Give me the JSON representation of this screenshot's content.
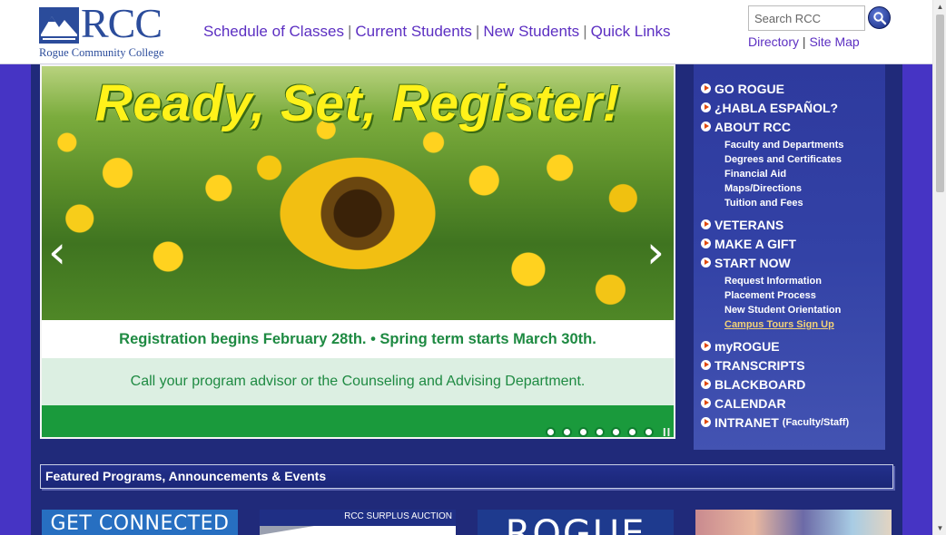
{
  "logo": {
    "abbr": "RCC",
    "name": "Rogue Community College"
  },
  "topnav": {
    "items": [
      "Schedule of Classes",
      "Current Students",
      "New Students",
      "Quick Links"
    ],
    "separator": "|"
  },
  "search": {
    "placeholder": "Search RCC",
    "button_icon": "search-icon"
  },
  "util_links": {
    "directory": "Directory",
    "separator": "|",
    "sitemap": "Site Map"
  },
  "hero": {
    "title": "Ready, Set, Register!",
    "line1": "Registration begins February 28th. • Spring term starts March 30th.",
    "line2": "Call your program advisor or the Counseling and Advising Department.",
    "prev_icon": "‹",
    "next_icon": "›",
    "slide_count": 7,
    "pause_icon": "II"
  },
  "rnav": {
    "go_rogue": "GO ROGUE",
    "espanol": "¿HABLA ESPAÑOL?",
    "about": "ABOUT RCC",
    "about_sub": [
      "Faculty and Departments",
      "Degrees and Certificates",
      "Financial Aid",
      "Maps/Directions",
      "Tuition and Fees"
    ],
    "veterans": "VETERANS",
    "gift": "MAKE A GIFT",
    "start": "START NOW",
    "start_sub": [
      "Request Information",
      "Placement Process",
      "New Student Orientation",
      "Campus Tours Sign Up"
    ],
    "myrogue": "myROGUE",
    "transcripts": "TRANSCRIPTS",
    "blackboard": "BLACKBOARD",
    "calendar": "CALENDAR",
    "intranet": "INTRANET",
    "intranet_note": "(Faculty/Staff)"
  },
  "featured": {
    "title": "Featured Programs, Announcements & Events"
  },
  "tiles": {
    "t1": "GET CONNECTED",
    "t2_caption": "RCC SURPLUS AUCTION",
    "t3": "ROGUE"
  },
  "colors": {
    "accent_link": "#5c2fc2",
    "nav_bg": "#202a7a",
    "band": "#4634c4",
    "hero_green": "#1a9a3c"
  }
}
